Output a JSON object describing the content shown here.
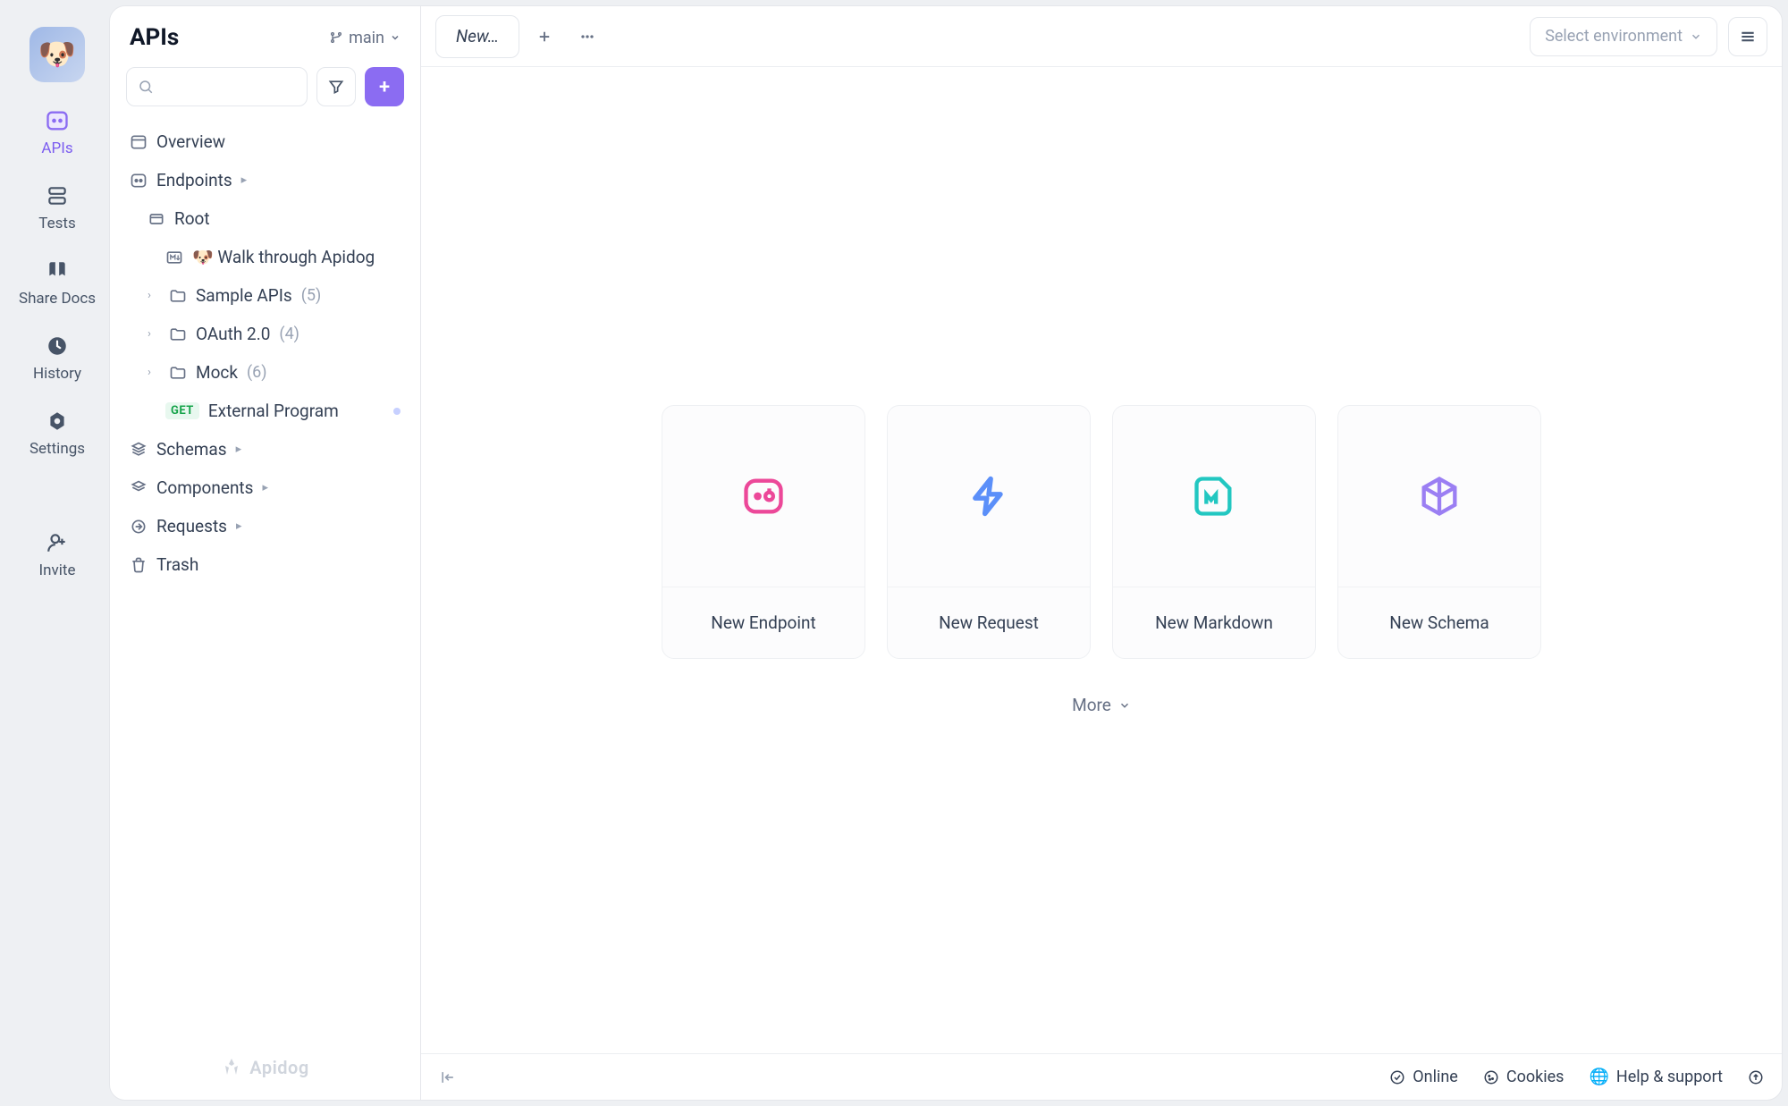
{
  "rail": {
    "items": [
      {
        "label": "APIs"
      },
      {
        "label": "Tests"
      },
      {
        "label": "Share Docs"
      },
      {
        "label": "History"
      },
      {
        "label": "Settings"
      }
    ],
    "invite_label": "Invite"
  },
  "side": {
    "title": "APIs",
    "branch": "main",
    "brand": "Apidog",
    "tree": {
      "overview": "Overview",
      "endpoints": "Endpoints",
      "root": "Root",
      "walk": "🐶 Walk through Apidog",
      "sample_apis": {
        "label": "Sample APIs",
        "count": "(5)"
      },
      "oauth": {
        "label": "OAuth 2.0",
        "count": "(4)"
      },
      "mock": {
        "label": "Mock",
        "count": "(6)"
      },
      "ext_prog": {
        "method": "GET",
        "label": "External Program"
      },
      "schemas": "Schemas",
      "components": "Components",
      "requests": "Requests",
      "trash": "Trash"
    }
  },
  "tabs": {
    "new_tab": "New…",
    "env_placeholder": "Select environment"
  },
  "cards": [
    {
      "label": "New Endpoint"
    },
    {
      "label": "New Request"
    },
    {
      "label": "New Markdown"
    },
    {
      "label": "New Schema"
    }
  ],
  "more_label": "More",
  "bottom": {
    "online": "Online",
    "cookies": "Cookies",
    "help": "Help & support"
  }
}
